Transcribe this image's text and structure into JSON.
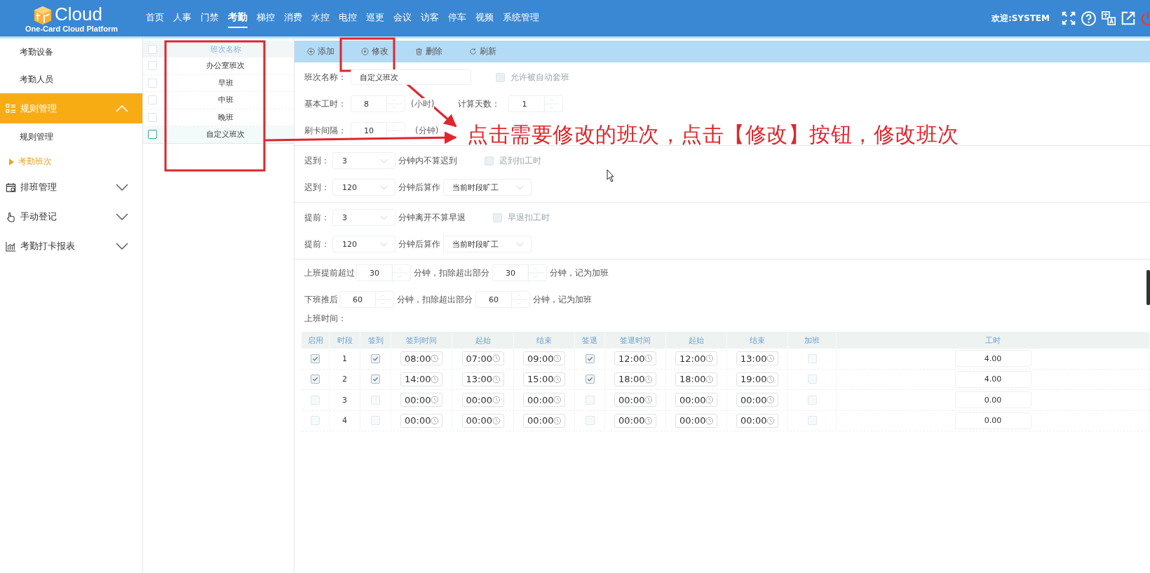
{
  "header": {
    "logo_text": "Cloud",
    "logo_subtitle": "One-Card Cloud Platform",
    "nav": [
      {
        "label": "首页",
        "selected": false
      },
      {
        "label": "人事",
        "selected": false
      },
      {
        "label": "门禁",
        "selected": false
      },
      {
        "label": "考勤",
        "selected": true
      },
      {
        "label": "梯控",
        "selected": false
      },
      {
        "label": "消费",
        "selected": false
      },
      {
        "label": "水控",
        "selected": false
      },
      {
        "label": "电控",
        "selected": false
      },
      {
        "label": "巡更",
        "selected": false
      },
      {
        "label": "会议",
        "selected": false
      },
      {
        "label": "访客",
        "selected": false
      },
      {
        "label": "停车",
        "selected": false
      },
      {
        "label": "视频",
        "selected": false
      },
      {
        "label": "系统管理",
        "selected": false
      }
    ],
    "welcome": "欢迎:SYSTEM"
  },
  "sidebar": {
    "items": [
      {
        "label": "考勤设备",
        "kind": "leaf",
        "selected": false
      },
      {
        "label": "考勤人员",
        "kind": "leaf",
        "selected": false
      },
      {
        "label": "规则管理",
        "kind": "group",
        "selected": true,
        "expanded": true,
        "children": [
          {
            "label": "规则管理",
            "selected": false
          },
          {
            "label": "考勤班次",
            "selected": true
          }
        ]
      },
      {
        "label": "排班管理",
        "kind": "group",
        "selected": false,
        "expanded": false
      },
      {
        "label": "手动登记",
        "kind": "group",
        "selected": false,
        "expanded": false
      },
      {
        "label": "考勤打卡报表",
        "kind": "group",
        "selected": false,
        "expanded": false
      }
    ]
  },
  "shift_list": {
    "header": "班次名称",
    "header_checked": false,
    "rows": [
      {
        "name": "办公室班次",
        "selected": false
      },
      {
        "name": "早班",
        "selected": false
      },
      {
        "name": "中班",
        "selected": false
      },
      {
        "name": "晚班",
        "selected": false
      },
      {
        "name": "自定义班次",
        "selected": true
      }
    ]
  },
  "toolbar": [
    {
      "label": "添加",
      "kind": "add"
    },
    {
      "label": "修改",
      "kind": "edit"
    },
    {
      "label": "删除",
      "kind": "delete"
    },
    {
      "label": "刷新",
      "kind": "refresh"
    }
  ],
  "form": {
    "name": {
      "label": "班次名称：",
      "value": "自定义班次"
    },
    "auto_apply": {
      "label": "允许被自动套班",
      "checked": false,
      "disabled": true
    },
    "base_hours": {
      "label": "基本工时：",
      "value": "8",
      "unit": "(小时)"
    },
    "calc_days": {
      "label": "计算天数：",
      "value": "1"
    },
    "swipe_interval": {
      "label": "刷卡间隔：",
      "value": "10",
      "unit": "(分钟)"
    },
    "rule_groups": [
      [
        {
          "kind": "grace",
          "label": "迟到：",
          "value": "3",
          "text": "分钟内不算迟到",
          "option": {
            "label": "迟到扣工时",
            "checked": false,
            "disabled": true
          }
        },
        {
          "kind": "penalty",
          "label": "迟到：",
          "value": "120",
          "text": "分钟后算作",
          "result": "当前时段旷工"
        }
      ],
      [
        {
          "kind": "grace",
          "label": "提前：",
          "value": "3",
          "text": "分钟离开不算早退",
          "option": {
            "label": "早退扣工时",
            "checked": false,
            "disabled": true
          }
        },
        {
          "kind": "penalty",
          "label": "提前：",
          "value": "120",
          "text": "分钟后算作",
          "result": "当前时段旷工"
        }
      ]
    ],
    "overtime": [
      {
        "label": "上班提前超过",
        "value": "30",
        "text": "分钟，扣除超出部分",
        "value_2": "30",
        "text_2": "分钟，记为加班"
      },
      {
        "label": "下班推后",
        "value": "60",
        "text": "分钟，扣除超出部分",
        "value_2": "60",
        "text_2": "分钟，记为加班"
      }
    ],
    "work_time_label": "上班时间："
  },
  "table": {
    "columns": [
      "启用",
      "时段",
      "签到",
      "签到时间",
      "起始",
      "结束",
      "签退",
      "签退时间",
      "起始",
      "结束",
      "加班",
      "工时"
    ],
    "rows": [
      {
        "enabled": true,
        "period": "1",
        "check_in": true,
        "check_in_time": "08:00",
        "start": "07:00",
        "end": "09:00",
        "check_out": true,
        "check_out_time": "12:00",
        "start_2": "12:00",
        "end_2": "13:00",
        "overtime": false,
        "hours": "4.00"
      },
      {
        "enabled": true,
        "period": "2",
        "check_in": true,
        "check_in_time": "14:00",
        "start": "13:00",
        "end": "15:00",
        "check_out": true,
        "check_out_time": "18:00",
        "start_2": "18:00",
        "end_2": "19:00",
        "overtime": false,
        "hours": "4.00"
      },
      {
        "enabled": false,
        "period": "3",
        "check_in": false,
        "check_in_time": "00:00",
        "start": "00:00",
        "end": "00:00",
        "check_out": false,
        "check_out_time": "00:00",
        "start_2": "00:00",
        "end_2": "00:00",
        "overtime": false,
        "hours": "0.00"
      },
      {
        "enabled": false,
        "period": "4",
        "check_in": false,
        "check_in_time": "00:00",
        "start": "00:00",
        "end": "00:00",
        "check_out": false,
        "check_out_time": "00:00",
        "start_2": "00:00",
        "end_2": "00:00",
        "overtime": false,
        "hours": "0.00"
      }
    ]
  },
  "annotation": {
    "text": "点击需要修改的班次，点击【修改】按钮，修改班次"
  }
}
